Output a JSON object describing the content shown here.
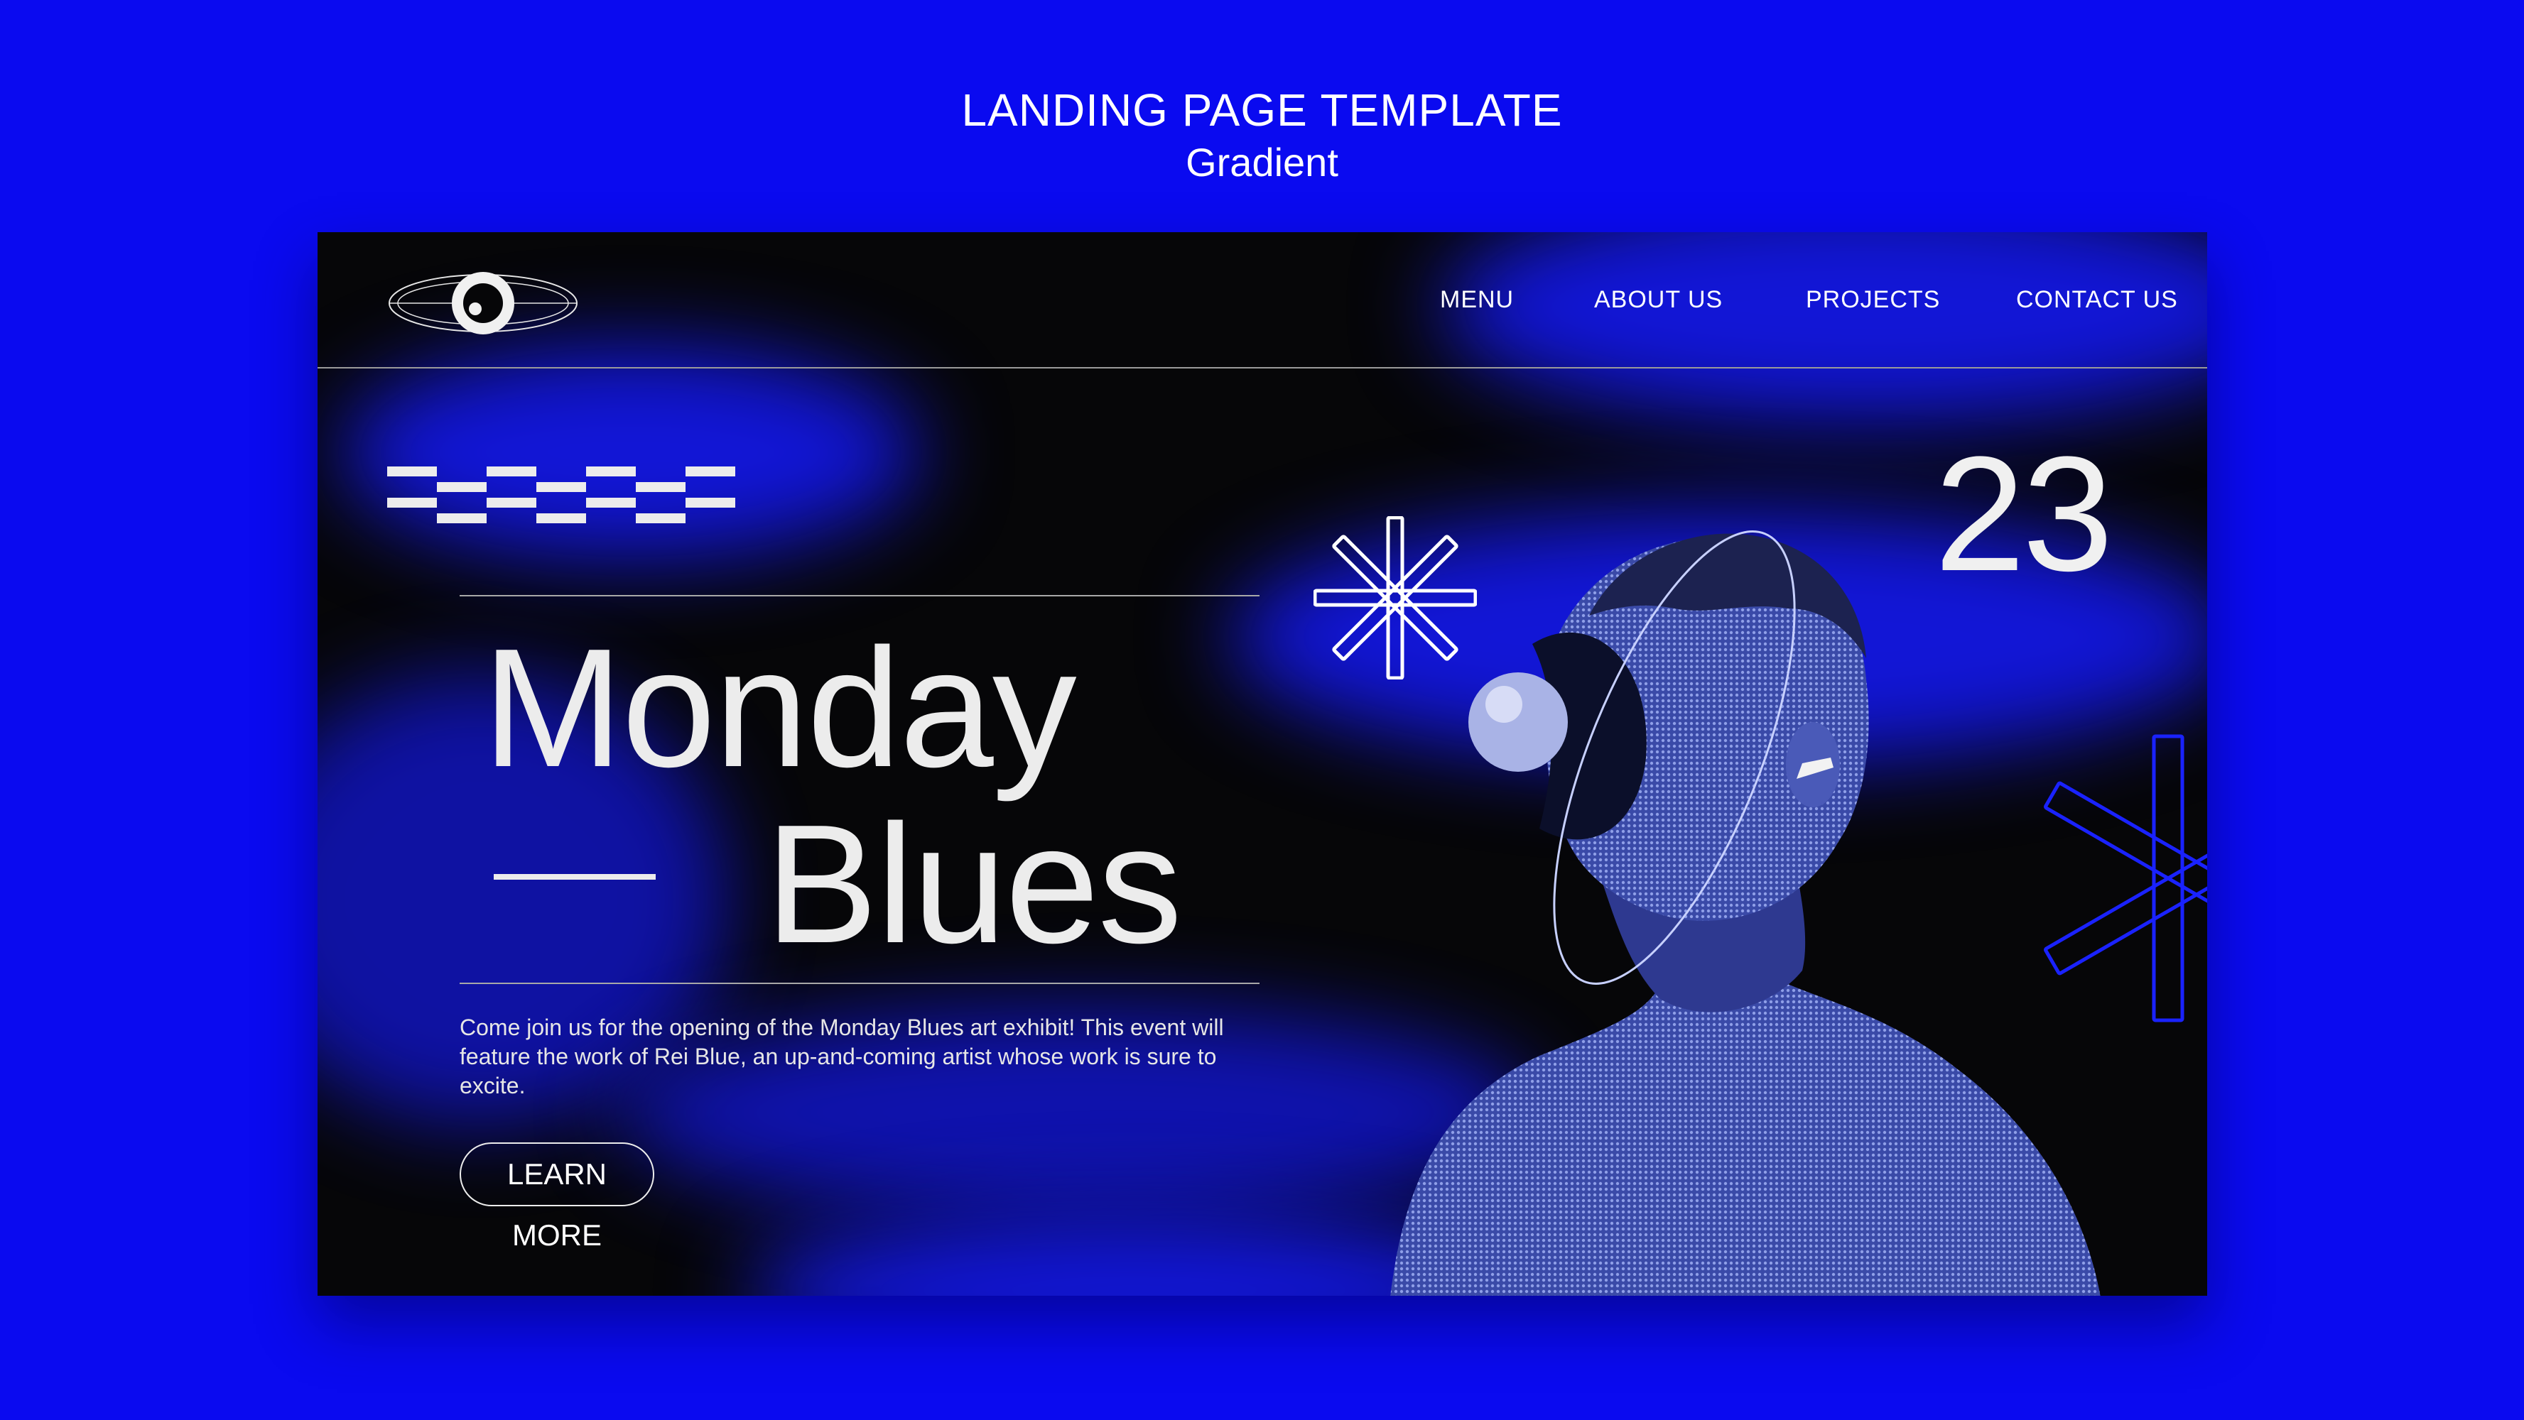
{
  "page": {
    "title": "LANDING PAGE TEMPLATE",
    "subtitle": "Gradient"
  },
  "nav": {
    "items": [
      "MENU",
      "ABOUT US",
      "PROJECTS",
      "CONTACT US"
    ]
  },
  "hero": {
    "headline_line1": "Monday",
    "headline_line2": "Blues",
    "number": "23",
    "description": "Come join us for the opening of the Monday Blues art exhibit! This event will feature the work of Rei Blue, an up-and-coming artist whose work is sure to excite.",
    "cta_label": "LEARN MORE"
  },
  "icons": {
    "logo": "eye-logo-icon",
    "pattern": "checker-pattern-icon",
    "sparkle_small": "asterisk-icon",
    "sparkle_large": "asterisk-outline-icon"
  },
  "colors": {
    "page_background": "#0a0af0",
    "card_background": "#060608",
    "accent_blue": "#1216d6",
    "text": "#ececec"
  }
}
